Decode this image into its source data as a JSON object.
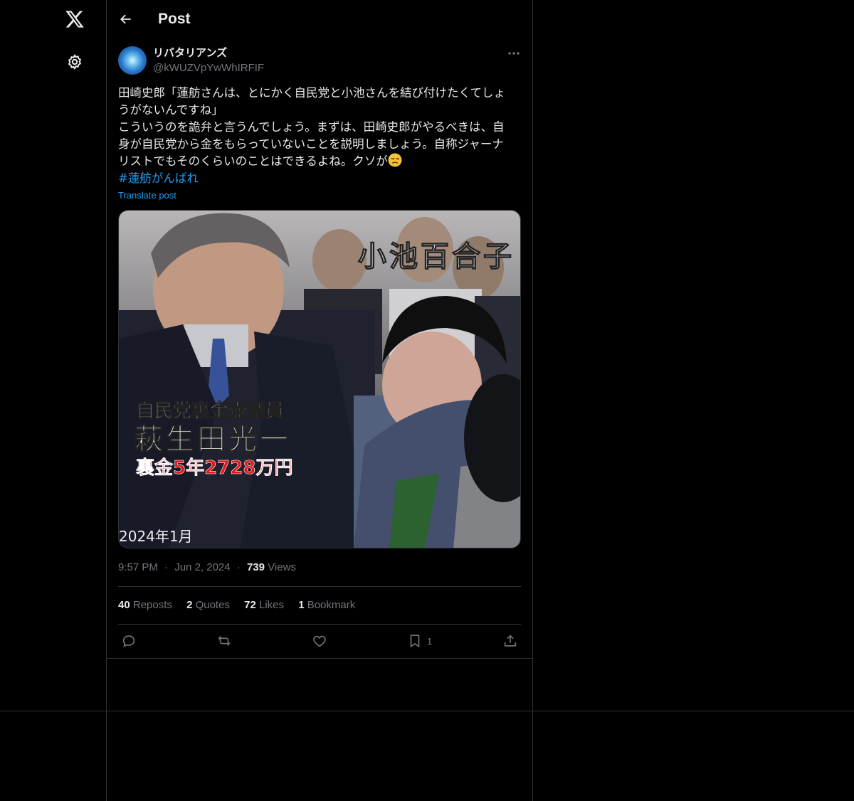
{
  "header": {
    "title": "Post"
  },
  "author": {
    "display_name": "リバタリアンズ",
    "handle": "@kWUZVpYwWhIRFIF"
  },
  "post": {
    "lines": [
      "田崎史郎「蓮舫さんは、とにかく自民党と小池さんを結び付けたくてしょ",
      "うがないんですね」",
      "こういうのを詭弁と言うんでしょう。まずは、田崎史郎がやるべきは、自",
      "身が自民党から金をもらっていないことを説明しましょう。自称ジャーナ",
      "リストでもそのくらいのことはできるよね。クソが"
    ],
    "emoji": "unamused-face",
    "hashtag": "#蓮舫がんばれ",
    "translate_label": "Translate post"
  },
  "media": {
    "name_top_right": "小池百合子",
    "caption_line1": "自民党裏金壺議員",
    "caption_line2": "萩生田光一",
    "caption_line3": "裏金5年2728万円",
    "date_label": "2024年1月"
  },
  "meta": {
    "time": "9:57 PM",
    "date": "Jun 2, 2024",
    "views_count": "739",
    "views_label": "Views",
    "sep": "·"
  },
  "stats": [
    {
      "count": "40",
      "label": "Reposts"
    },
    {
      "count": "2",
      "label": "Quotes"
    },
    {
      "count": "72",
      "label": "Likes"
    },
    {
      "count": "1",
      "label": "Bookmark"
    }
  ],
  "actions": {
    "bookmark_count": "1"
  },
  "colors": {
    "accent": "#1d9bf0",
    "muted": "#71767b",
    "border": "#2f3336",
    "text": "#e7e9ea"
  }
}
